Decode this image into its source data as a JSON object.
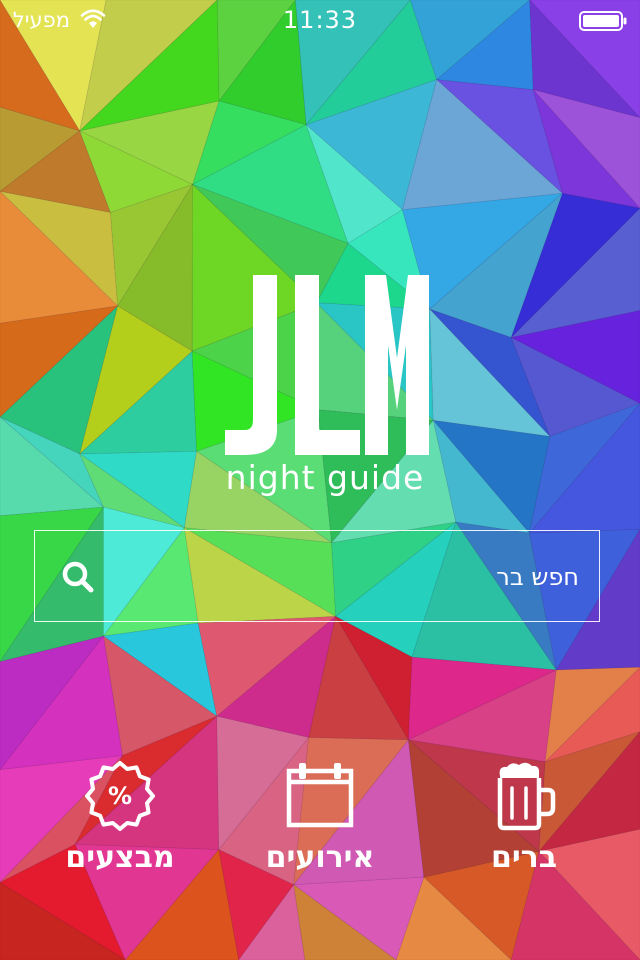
{
  "status_bar": {
    "carrier": "מפעיל",
    "time": "11:33"
  },
  "logo": {
    "mark": "JLM",
    "tagline": "night guide"
  },
  "search": {
    "placeholder": "חפש בר",
    "icon": "search-icon"
  },
  "nav": [
    {
      "label": "מבצעים",
      "icon": "percent-badge-icon"
    },
    {
      "label": "אירועים",
      "icon": "calendar-icon"
    },
    {
      "label": "ברים",
      "icon": "beer-mug-icon"
    }
  ]
}
